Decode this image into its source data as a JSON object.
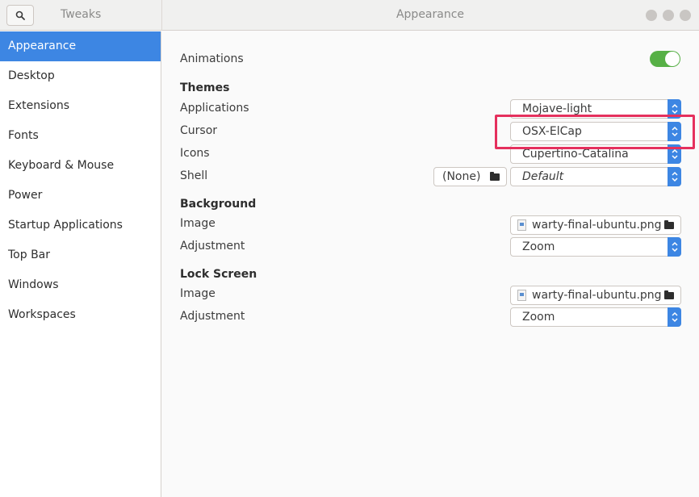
{
  "window": {
    "app_title": "Tweaks",
    "page_title": "Appearance"
  },
  "sidebar": {
    "items": [
      {
        "label": "Appearance",
        "active": true
      },
      {
        "label": "Desktop"
      },
      {
        "label": "Extensions"
      },
      {
        "label": "Fonts"
      },
      {
        "label": "Keyboard & Mouse"
      },
      {
        "label": "Power"
      },
      {
        "label": "Startup Applications"
      },
      {
        "label": "Top Bar"
      },
      {
        "label": "Windows"
      },
      {
        "label": "Workspaces"
      }
    ]
  },
  "main": {
    "animations": {
      "label": "Animations",
      "enabled": true
    },
    "themes": {
      "heading": "Themes",
      "applications": {
        "label": "Applications",
        "value": "Mojave-light"
      },
      "cursor": {
        "label": "Cursor",
        "value": "OSX-ElCap"
      },
      "icons": {
        "label": "Icons",
        "value": "Cupertino-Catalina"
      },
      "shell": {
        "label": "Shell",
        "file": "(None)",
        "value": "Default"
      }
    },
    "background": {
      "heading": "Background",
      "image": {
        "label": "Image",
        "value": "warty-final-ubuntu.png"
      },
      "adjustment": {
        "label": "Adjustment",
        "value": "Zoom"
      }
    },
    "lock_screen": {
      "heading": "Lock Screen",
      "image": {
        "label": "Image",
        "value": "warty-final-ubuntu.png"
      },
      "adjustment": {
        "label": "Adjustment",
        "value": "Zoom"
      }
    }
  },
  "colors": {
    "accent": "#3d86e3",
    "toggle_on": "#57b046",
    "highlight": "#e5305d"
  }
}
